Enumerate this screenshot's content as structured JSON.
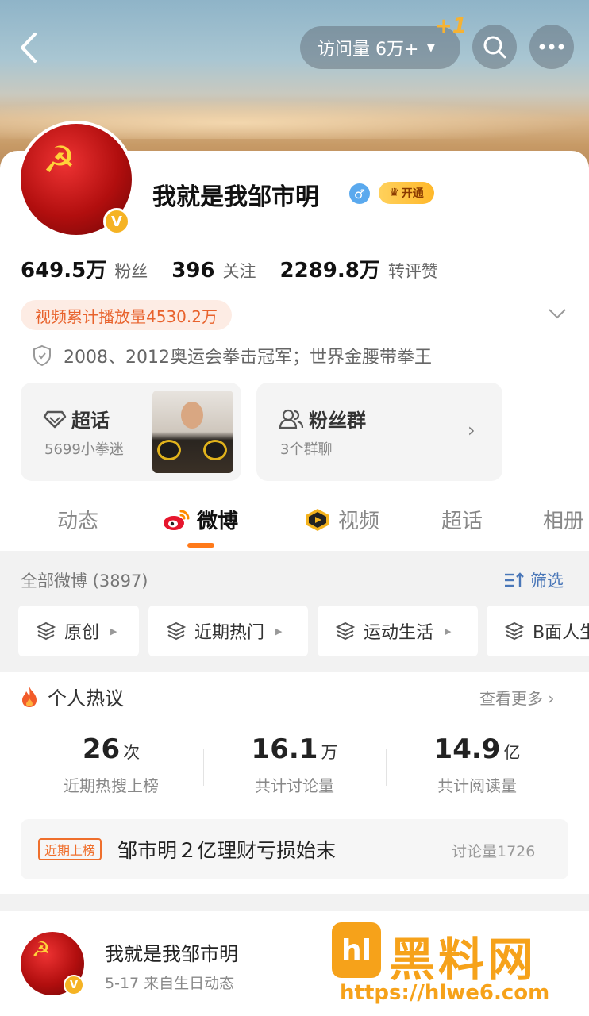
{
  "header": {
    "visits_label": "访问量 6万+",
    "plus_one": "+1",
    "back_icon": "chevron-left-icon",
    "search_icon": "search-icon",
    "more_icon": "more-dots-icon"
  },
  "profile": {
    "name": "我就是我邹市明",
    "verified_badge": "V",
    "vip_label": "开通",
    "stats": [
      {
        "value": "649.5万",
        "label": "粉丝"
      },
      {
        "value": "396",
        "label": "关注"
      },
      {
        "value": "2289.8万",
        "label": "转评赞"
      }
    ],
    "video_tag": "视频累计播放量4530.2万",
    "description": "2008、2012奥运会拳击冠军；世界金腰带拳王"
  },
  "boxes": {
    "supertopic": {
      "title": "超话",
      "sub": "5699小拳迷"
    },
    "fan_group": {
      "title": "粉丝群",
      "sub": "3个群聊"
    }
  },
  "tabs": [
    "动态",
    "微博",
    "视频",
    "超话",
    "相册"
  ],
  "filter": {
    "title": "全部微博 (3897)",
    "button": "筛选",
    "chips": [
      "原创",
      "近期热门",
      "运动生活",
      "B面人生"
    ]
  },
  "hot": {
    "title": "个人热议",
    "more": "查看更多",
    "metrics": [
      {
        "value": "26",
        "unit": "次",
        "label": "近期热搜上榜"
      },
      {
        "value": "16.1",
        "unit": "万",
        "label": "共计讨论量"
      },
      {
        "value": "14.9",
        "unit": "亿",
        "label": "共计阅读量"
      }
    ],
    "rank": {
      "tag": "近期上榜",
      "text": "邹市明２亿理财亏损始末",
      "count": "讨论量1726"
    }
  },
  "post": {
    "name": "我就是我邹市明",
    "meta": "5-17   来自生日动态"
  },
  "watermark": {
    "logo": "hl",
    "text": "黑料网",
    "url": "https://hlwe6.com"
  },
  "colors": {
    "accent": "#ff7a1a",
    "link": "#4a77b8",
    "tag": "#e8622c",
    "verified": "#f5b324"
  }
}
